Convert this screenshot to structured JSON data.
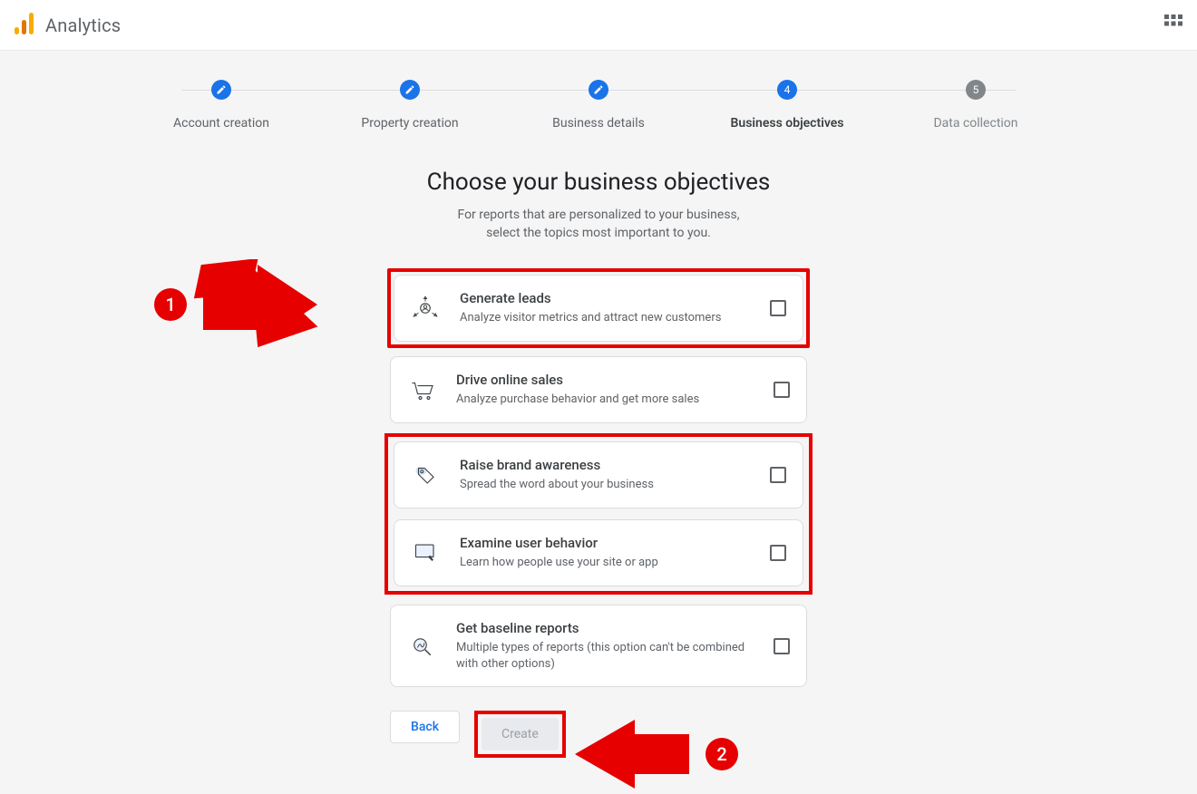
{
  "brand": "Analytics",
  "stepper": [
    {
      "label": "Account creation",
      "state": "done"
    },
    {
      "label": "Property creation",
      "state": "done"
    },
    {
      "label": "Business details",
      "state": "done"
    },
    {
      "label": "Business objectives",
      "state": "active",
      "number": "4"
    },
    {
      "label": "Data collection",
      "state": "pending",
      "number": "5"
    }
  ],
  "page": {
    "title": "Choose your business objectives",
    "sub_line1": "For reports that are personalized to your business,",
    "sub_line2": "select the topics most important to you."
  },
  "objectives": [
    {
      "id": "leads",
      "title": "Generate leads",
      "desc": "Analyze visitor metrics and attract new customers"
    },
    {
      "id": "sales",
      "title": "Drive online sales",
      "desc": "Analyze purchase behavior and get more sales"
    },
    {
      "id": "brand",
      "title": "Raise brand awareness",
      "desc": "Spread the word about your business"
    },
    {
      "id": "behavior",
      "title": "Examine user behavior",
      "desc": "Learn how people use your site or app"
    },
    {
      "id": "baseline",
      "title": "Get baseline reports",
      "desc": "Multiple types of reports (this option can't be combined with other options)"
    }
  ],
  "buttons": {
    "back": "Back",
    "create": "Create"
  },
  "annotations": {
    "a1": "1",
    "a2": "2"
  }
}
